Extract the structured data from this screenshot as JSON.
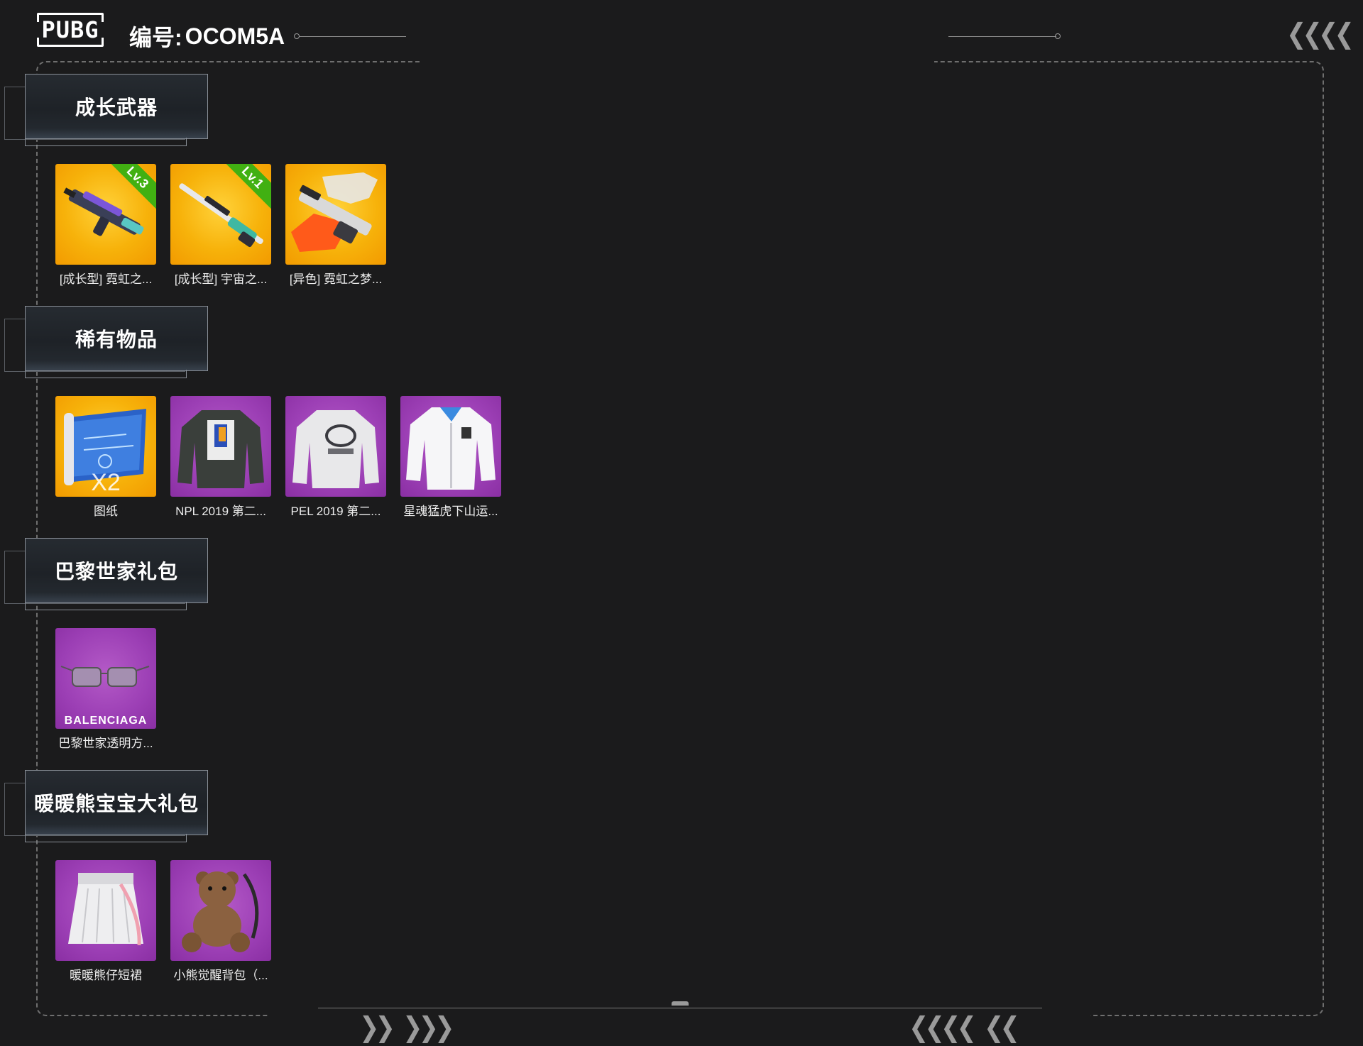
{
  "header": {
    "logo_text": "PUBG",
    "serial_label": "编号:",
    "serial_value": "OCOM5A"
  },
  "icons": {
    "left_chevrons": "chevrons-left-icon",
    "right_chevrons": "chevrons-right-icon"
  },
  "sections": [
    {
      "title": "成长武器",
      "items": [
        {
          "label": "[成长型] 霓虹之...",
          "bg": "gold",
          "badge": "Lv.3",
          "icon": "rifle-icon"
        },
        {
          "label": "[成长型] 宇宙之...",
          "bg": "gold",
          "badge": "Lv.1",
          "icon": "sniper-rifle-icon"
        },
        {
          "label": "[异色] 霓虹之梦...",
          "bg": "gold",
          "icon": "rifle-icon"
        }
      ]
    },
    {
      "title": "稀有物品",
      "items": [
        {
          "label": "图纸",
          "bg": "gold",
          "qty": "X2",
          "icon": "blueprint-icon"
        },
        {
          "label": "NPL 2019 第二...",
          "bg": "purple",
          "icon": "jacket-icon"
        },
        {
          "label": "PEL 2019 第二...",
          "bg": "purple",
          "icon": "jacket-icon"
        },
        {
          "label": "星魂猛虎下山运...",
          "bg": "purple",
          "icon": "jacket-icon"
        }
      ]
    },
    {
      "title": "巴黎世家礼包",
      "items": [
        {
          "label": "巴黎世家透明方...",
          "bg": "purple",
          "brand": "BALENCIAGA",
          "icon": "sunglasses-icon"
        }
      ]
    },
    {
      "title": "暖暖熊宝宝大礼包",
      "items": [
        {
          "label": "暖暖熊仔短裙",
          "bg": "purple",
          "icon": "skirt-icon"
        },
        {
          "label": "小熊觉醒背包（...",
          "bg": "purple",
          "icon": "teddy-bear-backpack-icon"
        }
      ]
    }
  ],
  "colors": {
    "background": "#1b1b1c",
    "gold_card": "#f7b20a",
    "purple_card": "#9c3fb5",
    "level_badge": "#41b012"
  }
}
